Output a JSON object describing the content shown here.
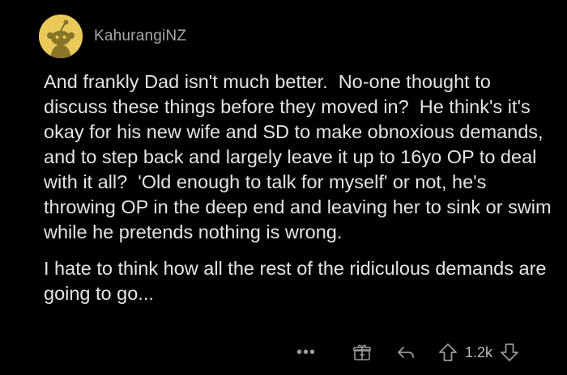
{
  "comment": {
    "username": "KahurangiNZ",
    "avatar_icon": "snoo-avatar-icon",
    "avatar_color": "#e8c95a",
    "paragraphs": [
      "And frankly Dad isn't much better.  No-one thought to discuss these things before they moved in?  He think's it's okay for his new wife and SD to make obnoxious demands, and to step back and largely leave it up to 16yo OP to deal with it all?  'Old enough to talk for myself' or not, he's throwing OP in the deep end and leaving her to sink or swim while he pretends nothing is wrong.",
      "I hate to think how all the rest of the ridiculous demands are going to go..."
    ]
  },
  "actions": {
    "more_label": "•••",
    "award_icon": "gift-award-icon",
    "reply_icon": "reply-arrow-icon",
    "upvote_icon": "upvote-arrow-icon",
    "score": "1.2k",
    "downvote_icon": "downvote-arrow-icon"
  }
}
